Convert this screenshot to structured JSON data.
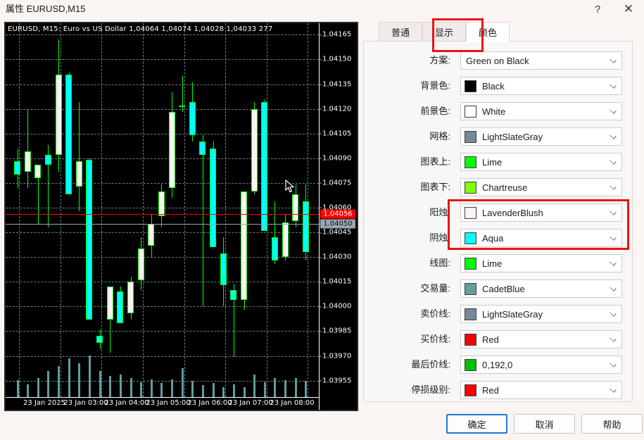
{
  "window": {
    "title": "属性 EURUSD,M15",
    "help_icon": "?",
    "close_icon": "✕",
    "help_name": "help-icon",
    "close_name": "close-icon"
  },
  "tabs": [
    {
      "label": "普通",
      "active": false
    },
    {
      "label": "显示",
      "active": false
    },
    {
      "label": "颜色",
      "active": true
    }
  ],
  "fields": [
    {
      "label": "方案:",
      "value": "Green on Black",
      "swatch": null,
      "name": "scheme"
    },
    {
      "label": "背景色:",
      "value": "Black",
      "swatch": "#000000",
      "name": "background-color"
    },
    {
      "label": "前景色:",
      "value": "White",
      "swatch": "#ffffff",
      "name": "foreground-color"
    },
    {
      "label": "网格:",
      "value": "LightSlateGray",
      "swatch": "#778899",
      "name": "grid-color"
    },
    {
      "label": "图表上:",
      "value": "Lime",
      "swatch": "#00ff00",
      "name": "bar-up-color"
    },
    {
      "label": "图表下:",
      "value": "Chartreuse",
      "swatch": "#7fff00",
      "name": "bar-down-color"
    },
    {
      "label": "阳烛:",
      "value": "LavenderBlush",
      "swatch": "#fff0f5",
      "name": "bull-candle-color"
    },
    {
      "label": "阴烛:",
      "value": "Aqua",
      "swatch": "#00ffff",
      "name": "bear-candle-color"
    },
    {
      "label": "线图:",
      "value": "Lime",
      "swatch": "#00ff00",
      "name": "line-chart-color"
    },
    {
      "label": "交易量:",
      "value": "CadetBlue",
      "swatch": "#5f9ea0",
      "name": "volume-color"
    },
    {
      "label": "卖价线:",
      "value": "LightSlateGray",
      "swatch": "#778899",
      "name": "ask-line-color"
    },
    {
      "label": "买价线:",
      "value": "Red",
      "swatch": "#ff0000",
      "name": "bid-line-color"
    },
    {
      "label": "最后价线:",
      "value": "0,192,0",
      "swatch": "#00c000",
      "name": "last-price-line-color"
    },
    {
      "label": "停损级别:",
      "value": "Red",
      "swatch": "#ff0000",
      "name": "stop-level-color"
    }
  ],
  "highlights": {
    "accent": "#ee1111"
  },
  "buttons": [
    {
      "label": "确定",
      "name": "ok-button",
      "primary": true
    },
    {
      "label": "取消",
      "name": "cancel-button",
      "primary": false
    },
    {
      "label": "帮助",
      "name": "help-button",
      "primary": false
    }
  ],
  "chart_data": {
    "type": "candlestick",
    "title": "EURUSD, M15:  Euro vs US Dollar  1,04064 1,04074 1,04028 1,04033  277",
    "symbol": "EURUSD",
    "timeframe": "M15",
    "description": "Euro vs US Dollar",
    "quote": {
      "open": "1,04064",
      "high": "1,04074",
      "low": "1,04028",
      "close": "1,04033",
      "volume": "277"
    },
    "xlabel": "",
    "ylabel": "",
    "ylim": [
      1.03945,
      1.04172
    ],
    "y_ticks": [
      1.04165,
      1.0415,
      1.04135,
      1.0412,
      1.04105,
      1.0409,
      1.04075,
      1.0406,
      1.04045,
      1.0403,
      1.04015,
      1.04,
      1.03985,
      1.0397,
      1.03955
    ],
    "y_tick_labels": [
      "1.04165",
      "1.04150",
      "1.04135",
      "1.04120",
      "1.04105",
      "1.04090",
      "1.04075",
      "1.04060",
      "1.04045",
      "1.04030",
      "1.04015",
      "1.04000",
      "1.03985",
      "1.03970",
      "1.03955"
    ],
    "x_tick_labels": [
      "23 Jan 2025",
      "23 Jan 03:00",
      "23 Jan 04:00",
      "23 Jan 05:00",
      "23 Jan 06:00",
      "23 Jan 07:00",
      "23 Jan 08:00"
    ],
    "grid": true,
    "price_markers": [
      {
        "value": "1.04056",
        "style": "red"
      },
      {
        "value": "1.04050",
        "style": "gray"
      }
    ],
    "bid_line": 1.04056,
    "ask_line": 1.0405,
    "colors": {
      "background": "#000000",
      "grid": "#6e7b8b",
      "bull_body": "#fff0f5",
      "bear_body": "#00ffff",
      "candle_outline": "#00ff00",
      "wick": "#00ff00",
      "volume": "#5f9ea0",
      "bid_line": "#ff0000",
      "ask_line": "#9aa5b1"
    },
    "candles": [
      {
        "o": 1.04088,
        "h": 1.04096,
        "l": 1.04072,
        "c": 1.0408,
        "v": 1.7
      },
      {
        "o": 1.04082,
        "h": 1.0412,
        "l": 1.04072,
        "c": 1.04094,
        "v": 1.3
      },
      {
        "o": 1.04078,
        "h": 1.04086,
        "l": 1.0405,
        "c": 1.04086,
        "v": 1.9
      },
      {
        "o": 1.04092,
        "h": 1.04098,
        "l": 1.04048,
        "c": 1.04086,
        "v": 2.6
      },
      {
        "o": 1.04092,
        "h": 1.04162,
        "l": 1.04082,
        "c": 1.04141,
        "v": 3.1
      },
      {
        "o": 1.04141,
        "h": 1.04142,
        "l": 1.04068,
        "c": 1.04068,
        "v": 3.9
      },
      {
        "o": 1.04073,
        "h": 1.04124,
        "l": 1.04058,
        "c": 1.04088,
        "v": 3.4
      },
      {
        "o": 1.04089,
        "h": 1.0409,
        "l": 1.03992,
        "c": 1.03992,
        "v": 4.2
      },
      {
        "o": 1.03982,
        "h": 1.03986,
        "l": 1.03974,
        "c": 1.03978,
        "v": 2.6
      },
      {
        "o": 1.03992,
        "h": 1.04,
        "l": 1.03972,
        "c": 1.04012,
        "v": 2.1
      },
      {
        "o": 1.04009,
        "h": 1.04012,
        "l": 1.0399,
        "c": 1.0399,
        "v": 2.3
      },
      {
        "o": 1.03996,
        "h": 1.04018,
        "l": 1.03992,
        "c": 1.04015,
        "v": 1.9
      },
      {
        "o": 1.04016,
        "h": 1.04042,
        "l": 1.0401,
        "c": 1.04035,
        "v": 1.5
      },
      {
        "o": 1.04037,
        "h": 1.04056,
        "l": 1.0403,
        "c": 1.0405,
        "v": 1.8
      },
      {
        "o": 1.04055,
        "h": 1.04074,
        "l": 1.04048,
        "c": 1.0407,
        "v": 1.4
      },
      {
        "o": 1.04072,
        "h": 1.0413,
        "l": 1.04066,
        "c": 1.04118,
        "v": 1.8
      },
      {
        "o": 1.04121,
        "h": 1.0414,
        "l": 1.04118,
        "c": 1.04122,
        "v": 2.9
      },
      {
        "o": 1.04124,
        "h": 1.04136,
        "l": 1.041,
        "c": 1.04104,
        "v": 1.6
      },
      {
        "o": 1.041,
        "h": 1.04104,
        "l": 1.04,
        "c": 1.04092,
        "v": 1.2
      },
      {
        "o": 1.04096,
        "h": 1.041,
        "l": 1.04036,
        "c": 1.04036,
        "v": 1.4
      },
      {
        "o": 1.04032,
        "h": 1.04042,
        "l": 1.04,
        "c": 1.04013,
        "v": 1.0
      },
      {
        "o": 1.0401,
        "h": 1.04014,
        "l": 1.0397,
        "c": 1.04004,
        "v": 1.3
      },
      {
        "o": 1.04004,
        "h": 1.0407,
        "l": 1.03998,
        "c": 1.0407,
        "v": 1.0
      },
      {
        "o": 1.0407,
        "h": 1.04124,
        "l": 1.04068,
        "c": 1.0412,
        "v": 2.3
      },
      {
        "o": 1.04124,
        "h": 1.04126,
        "l": 1.04046,
        "c": 1.04046,
        "v": 1.5
      },
      {
        "o": 1.04042,
        "h": 1.04064,
        "l": 1.04026,
        "c": 1.04028,
        "v": 1.9
      },
      {
        "o": 1.0403,
        "h": 1.04056,
        "l": 1.04028,
        "c": 1.04051,
        "v": 1.7
      },
      {
        "o": 1.04052,
        "h": 1.04074,
        "l": 1.04048,
        "c": 1.04068,
        "v": 1.9
      },
      {
        "o": 1.04064,
        "h": 1.04074,
        "l": 1.04028,
        "c": 1.04033,
        "v": 1.6
      }
    ]
  }
}
